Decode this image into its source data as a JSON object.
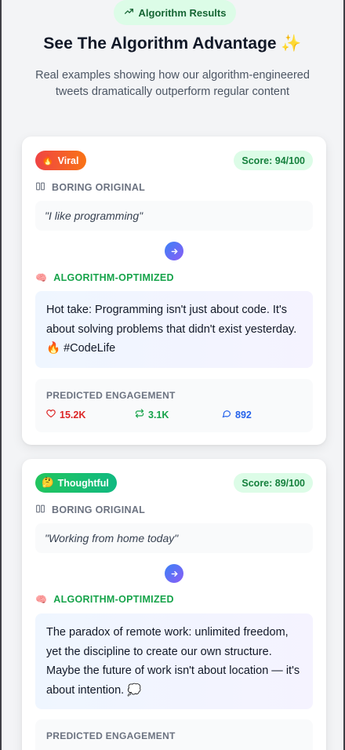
{
  "header": {
    "pill_label": "Algorithm Results",
    "pill_icon": "trending-up-icon",
    "title": "See The Algorithm Advantage ✨",
    "subtitle": "Real examples showing how our algorithm-engineered tweets dramatically outperform regular content"
  },
  "colors": {
    "accent_green": "#16a34a",
    "viral_gradient": [
      "#ef4444",
      "#f97316"
    ],
    "thoughtful_gradient": [
      "#22c55e",
      "#10b981"
    ],
    "arrow_gradient": [
      "#3b82f6",
      "#8b5cf6"
    ]
  },
  "examples": [
    {
      "badge_emoji": "🔥",
      "badge_label": "Viral",
      "score": "Score: 94/100",
      "original_label": "BORING ORIGINAL",
      "original_text": "\"I like programming\"",
      "optimized_label": "ALGORITHM-OPTIMIZED",
      "optimized_text": "Hot take: Programming isn't just about code. It's about solving problems that didn't exist yesterday. 🔥 #CodeLife",
      "engagement_label": "PREDICTED ENGAGEMENT",
      "likes": "15.2K",
      "retweets": "3.1K",
      "replies": "892"
    },
    {
      "badge_emoji": "🤔",
      "badge_label": "Thoughtful",
      "score": "Score: 89/100",
      "original_label": "BORING ORIGINAL",
      "original_text": "\"Working from home today\"",
      "optimized_label": "ALGORITHM-OPTIMIZED",
      "optimized_text": "The paradox of remote work: unlimited freedom, yet the discipline to create our own structure. Maybe the future of work isn't about location — it's about intention. 💭",
      "engagement_label": "PREDICTED ENGAGEMENT"
    }
  ]
}
